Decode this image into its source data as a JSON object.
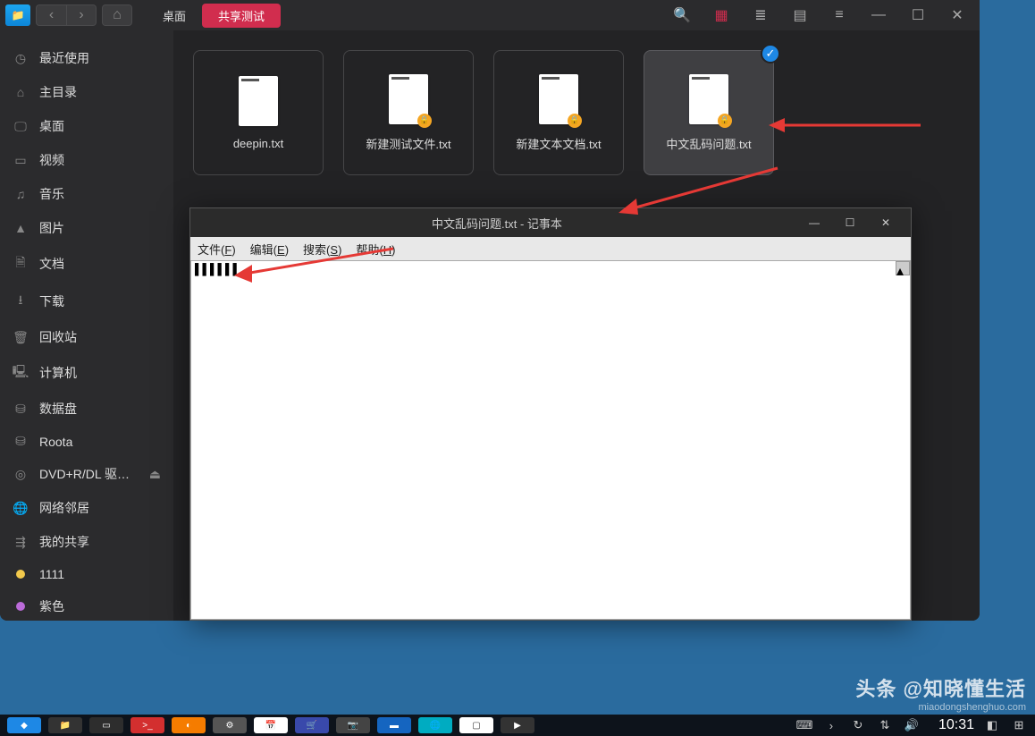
{
  "fileManager": {
    "breadcrumb": {
      "item1": "桌面",
      "item2": "共享测试"
    },
    "sidebar": [
      {
        "icon": "clock",
        "label": "最近使用"
      },
      {
        "icon": "home",
        "label": "主目录"
      },
      {
        "icon": "desktop",
        "label": "桌面"
      },
      {
        "icon": "video",
        "label": "视频"
      },
      {
        "icon": "music",
        "label": "音乐"
      },
      {
        "icon": "image",
        "label": "图片"
      },
      {
        "icon": "doc",
        "label": "文档"
      },
      {
        "icon": "download",
        "label": "下载"
      },
      {
        "icon": "trash",
        "label": "回收站"
      },
      {
        "icon": "computer",
        "label": "计算机"
      },
      {
        "icon": "disk",
        "label": "数据盘"
      },
      {
        "icon": "disk",
        "label": "Roota"
      },
      {
        "icon": "disc",
        "label": "DVD+R/DL 驱…",
        "eject": true
      },
      {
        "icon": "network",
        "label": "网络邻居"
      },
      {
        "icon": "share",
        "label": "我的共享"
      },
      {
        "icon": "dot",
        "label": "1111",
        "color": "#f2c94c"
      },
      {
        "icon": "dot",
        "label": "紫色",
        "color": "#bb6bd9"
      }
    ],
    "files": [
      {
        "name": "deepin.txt",
        "locked": false,
        "selected": false
      },
      {
        "name": "新建测试文件.txt",
        "locked": true,
        "selected": false
      },
      {
        "name": "新建文本文档.txt",
        "locked": true,
        "selected": false
      },
      {
        "name": "中文乱码问题.txt",
        "locked": true,
        "selected": true,
        "checked": true
      }
    ]
  },
  "notepad": {
    "title": "中文乱码问题.txt - 记事本",
    "menu": {
      "file": "文件",
      "file_key": "F",
      "edit": "编辑",
      "edit_key": "E",
      "search": "搜索",
      "search_key": "S",
      "help": "帮助",
      "help_key": "H"
    },
    "content": "▌▌▌▌▌▌"
  },
  "taskbar": {
    "clock": "10:31"
  },
  "watermark": {
    "line1": "头条 @知晓懂生活",
    "line2": "miaodongshenghuo.com"
  },
  "icons": {
    "back": "‹",
    "forward": "›",
    "home_nav": "⌂",
    "search": "🔍",
    "grid": "▦",
    "list": "≣",
    "column": "▤",
    "menu": "≡",
    "minimize": "—",
    "maximize": "☐",
    "close": "✕",
    "check": "✓",
    "lock": "🔒",
    "eject": "⏏",
    "clock": "◷",
    "home": "⌂",
    "desktop": "🖵",
    "video": "▭",
    "music": "♫",
    "image": "▲",
    "doc": "🗎",
    "download": "⭳",
    "trash": "🗑",
    "computer": "🖳",
    "disk": "⛁",
    "disc": "◎",
    "network": "🌐",
    "share": "⇶"
  }
}
